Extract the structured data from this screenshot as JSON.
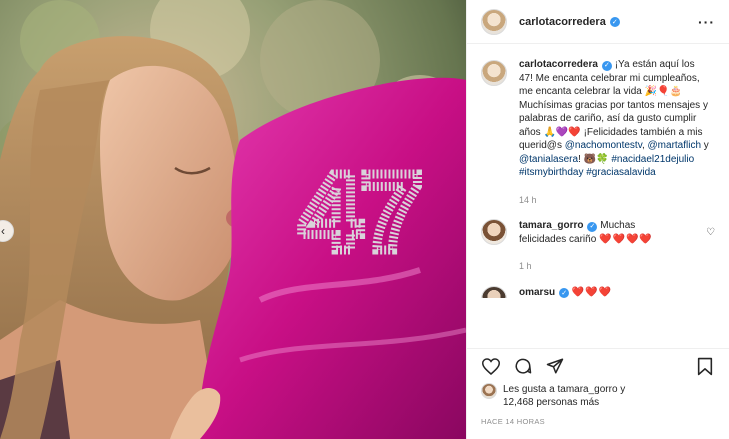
{
  "post": {
    "author": "carlotacorredera",
    "caption_parts": {
      "text1": "¡Ya están aquí los 47! Me encanta celebrar mi cumpleaños, me encanta celebrar la vida 🎉🎈🎂 Muchísimas gracias por tantos mensajes y palabras de cariño, así da gusto cumplir años 🙏💜❤️ ¡Felicidades también a mis querid@s ",
      "mention1": "@nachomontestv",
      "sep1": ", ",
      "mention2": "@martaflich",
      "text2": " y ",
      "mention3": "@tanialasera",
      "text3": "! 🐻🍀 ",
      "hashtag1": "#nacidael21dejulio",
      "space1": " ",
      "hashtag2": "#itsmybirthday",
      "space2": " ",
      "hashtag3": "#graciasalavida"
    },
    "caption_time": "14 h",
    "image_text": "47"
  },
  "comments": [
    {
      "user": "tamara_gorro",
      "text": " Muchas felicidades cariño ",
      "hearts": "❤️❤️❤️❤️",
      "time": "1 h"
    },
    {
      "user": "omarsu",
      "hearts": "❤️❤️❤️"
    }
  ],
  "likes": {
    "line1": "Les gusta a tamara_gorro y",
    "line2": "12,468 personas más"
  },
  "timestamp": "HACE 14 HORAS",
  "icons": {
    "verified": "verified-badge-icon",
    "more": "more-options-icon",
    "like": "heart-icon",
    "comment": "comment-icon",
    "share": "paper-plane-icon",
    "save": "bookmark-icon",
    "carousel": "chevron-left-icon"
  },
  "colors": {
    "accent_blue": "#3897f0",
    "link": "#00376b",
    "heart_red": "#ed4956",
    "balloon_pink": "#d6168a"
  }
}
